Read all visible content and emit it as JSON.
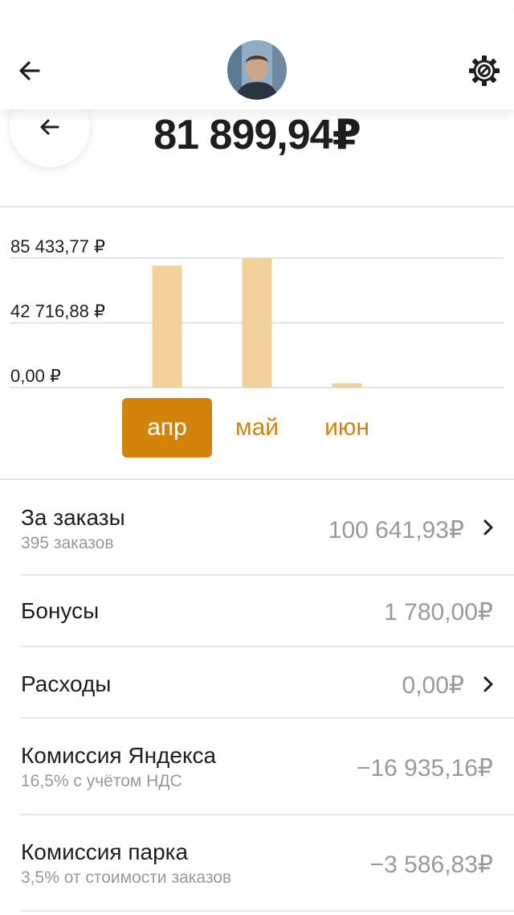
{
  "header": {
    "back_icon": "arrow-left-icon",
    "settings_icon": "gear-icon"
  },
  "balance": {
    "total": "81 899,94₽"
  },
  "chart_data": {
    "type": "bar",
    "categories": [
      "апр",
      "май",
      "июн"
    ],
    "values": [
      80500,
      85433.77,
      2800
    ],
    "ylim": [
      0,
      85433.77
    ],
    "ytick_labels": [
      "85 433,77 ₽",
      "42 716,88 ₽",
      "0,00 ₽"
    ],
    "ytick_values": [
      85433.77,
      42716.88,
      0
    ],
    "bar_color": "#f2d29b",
    "selected": "апр",
    "accent_color": "#d4830a"
  },
  "rows": [
    {
      "title": "За заказы",
      "subtitle": "395 заказов",
      "amount": "100 641,93₽",
      "chevron": true
    },
    {
      "title": "Бонусы",
      "subtitle": "",
      "amount": "1 780,00₽",
      "chevron": false
    },
    {
      "title": "Расходы",
      "subtitle": "",
      "amount": "0,00₽",
      "chevron": true
    },
    {
      "title": "Комиссия Яндекса",
      "subtitle": "16,5% с учётом НДС",
      "amount": "−16 935,16₽",
      "chevron": false
    },
    {
      "title": "Комиссия парка",
      "subtitle": "3,5% от стоимости заказов",
      "amount": "−3 586,83₽",
      "chevron": false
    }
  ]
}
